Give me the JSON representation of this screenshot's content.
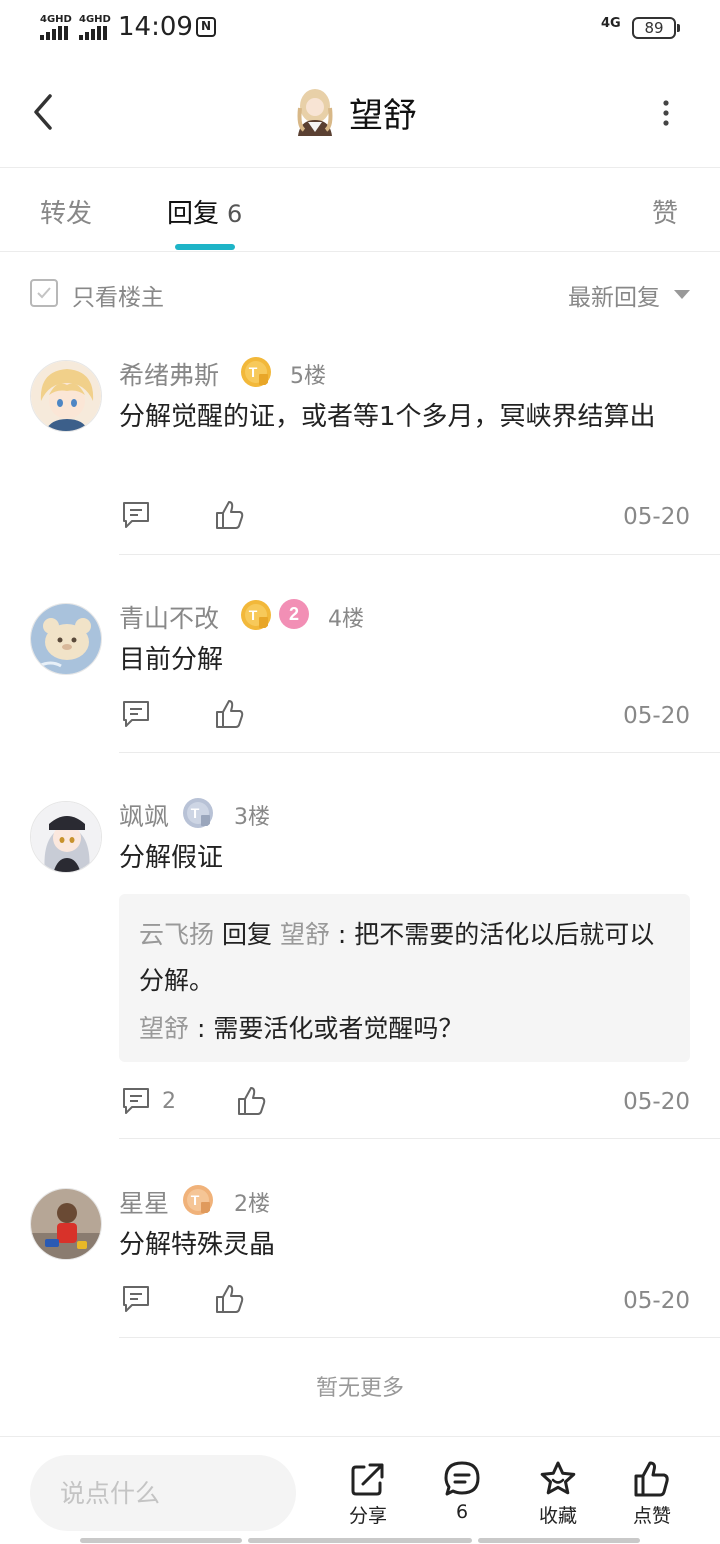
{
  "status_bar": {
    "signal1": "4GHD",
    "signal2": "4GHD",
    "time": "14:09",
    "mute_glyph": "N",
    "network": "4G",
    "battery": "89"
  },
  "header": {
    "title": "望舒",
    "back_icon": "chevron-left-icon",
    "more_icon": "more-vertical-icon"
  },
  "tabs": [
    {
      "label": "转发"
    },
    {
      "label": "回复",
      "count": "6"
    },
    {
      "label": "赞"
    }
  ],
  "filter": {
    "only_op_label": "只看楼主",
    "sort_label": "最新回复"
  },
  "comments": [
    {
      "name": "希绪弗斯",
      "floor": "5楼",
      "text": "分解觉醒的证，或者等1个多月，冥峡界结算出",
      "date": "05-20"
    },
    {
      "name": "青山不改",
      "floor": "4楼",
      "text": "目前分解",
      "date": "05-20",
      "level_badge": "2"
    },
    {
      "name": "飒飒",
      "floor": "3楼",
      "text": "分解假证",
      "date": "05-20",
      "reply_count": "2",
      "replies": [
        {
          "from": "云飞扬",
          "verb": "回复",
          "to": "望舒",
          "text": "把不需要的活化以后就可以分解。"
        },
        {
          "from": "望舒",
          "text": "需要活化或者觉醒吗？"
        }
      ]
    },
    {
      "name": "星星",
      "floor": "2楼",
      "text": "分解特殊灵晶",
      "date": "05-20"
    }
  ],
  "no_more": "暂无更多",
  "bottom_bar": {
    "input_placeholder": "说点什么",
    "share_label": "分享",
    "comment_count": "6",
    "favorite_label": "收藏",
    "like_label": "点赞"
  },
  "colors": {
    "accent": "#1eb4c7",
    "badge_gold": "#f2b83a",
    "badge_silver": "#b8c2d6",
    "badge_pink": "#f28fb5"
  }
}
